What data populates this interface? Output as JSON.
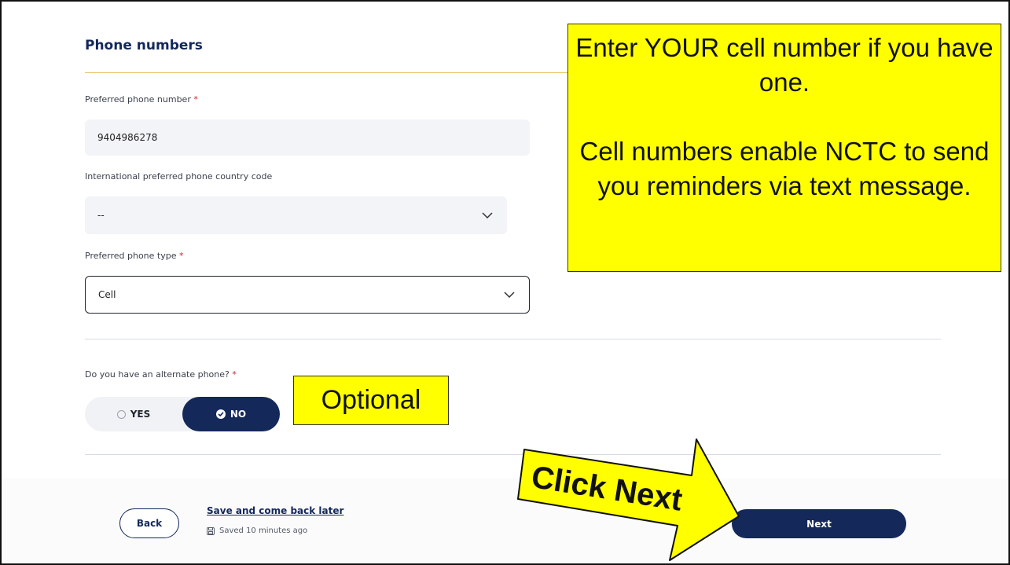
{
  "section": {
    "title": "Phone numbers"
  },
  "preferred_phone": {
    "label": "Preferred phone number",
    "required_mark": "*",
    "value": "9404986278"
  },
  "country_code": {
    "label": "International preferred phone country code",
    "selected": "--"
  },
  "phone_type": {
    "label": "Preferred phone type",
    "required_mark": "*",
    "selected": "Cell"
  },
  "alternate_phone": {
    "question": "Do you have an alternate phone?",
    "required_mark": "*",
    "yes_label": "YES",
    "no_label": "NO",
    "selected": "NO"
  },
  "footer": {
    "back_label": "Back",
    "save_later_label": "Save and come back later",
    "saved_status": "Saved 10 minutes ago",
    "next_label": "Next"
  },
  "annotations": {
    "main_callout_line1": "Enter YOUR cell number if you have one.",
    "main_callout_line2": "Cell numbers enable NCTC to send you reminders via text message.",
    "optional_callout": "Optional",
    "arrow_callout": "Click Next"
  },
  "colors": {
    "primary": "#14285a",
    "callout_yellow": "#ffff00",
    "required_red": "#d11f2f"
  }
}
